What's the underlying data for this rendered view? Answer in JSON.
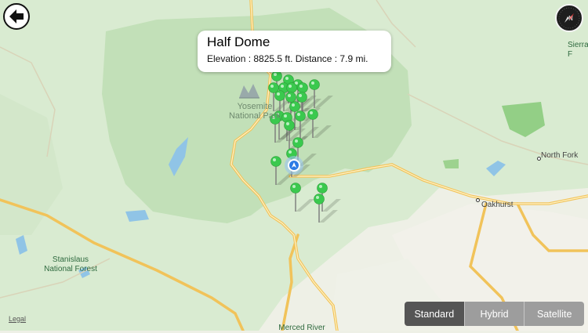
{
  "callout": {
    "title": "Half Dome",
    "subtitle": "Elevation : 8825.5 ft.  Distance : 7.9 mi."
  },
  "labels": {
    "park": "Yosemite\nNational Park",
    "stanislaus": "Stanislaus\nNational Forest",
    "sierra": "Sierra\nF",
    "north_fork": "North Fork",
    "oakhurst": "Oakhurst",
    "merced": "Merced River"
  },
  "map_types": {
    "options": [
      "Standard",
      "Hybrid",
      "Satellite"
    ],
    "selected": "Standard"
  },
  "legal": "Legal",
  "icons": {
    "back": "back-arrow-icon",
    "compass": "compass-icon",
    "user_location": "user-location-icon",
    "pin": "map-pin-icon",
    "park": "national-park-icon"
  },
  "colors": {
    "park_fill": "#c3e0b9",
    "forest_fill": "#d7ead0",
    "land": "#eef0e6",
    "road": "#f7d47b",
    "water": "#90c4e6",
    "pin": "#3ac94e",
    "user_location": "#2c7be5",
    "segment_active": "#555555",
    "segment_inactive": "#9d9d9d"
  },
  "pins_count": 24
}
